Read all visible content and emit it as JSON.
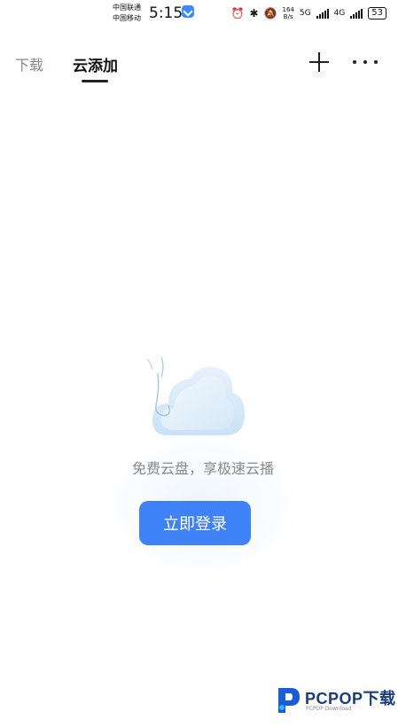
{
  "status_bar": {
    "carrier_1": "中国联通",
    "carrier_2": "中国移动",
    "time": "5:15",
    "net_speed_value": "164",
    "net_speed_unit": "B/s",
    "network_1": "5G",
    "network_2": "4G",
    "battery": "53"
  },
  "tabs": [
    {
      "label": "下载",
      "active": false
    },
    {
      "label": "云添加",
      "active": true
    }
  ],
  "toolbar": {
    "add_icon": "plus-icon",
    "more_icon": "more-icon"
  },
  "empty_state": {
    "illustration": "cloud-icon",
    "message": "免费云盘，享极速云播",
    "login_label": "立即登录"
  },
  "watermark": {
    "brand": "PCPOP下载",
    "sub": "PCPOP Download"
  },
  "colors": {
    "accent": "#3f82f7",
    "text_primary": "#111111",
    "text_secondary": "#8a8a8a"
  }
}
